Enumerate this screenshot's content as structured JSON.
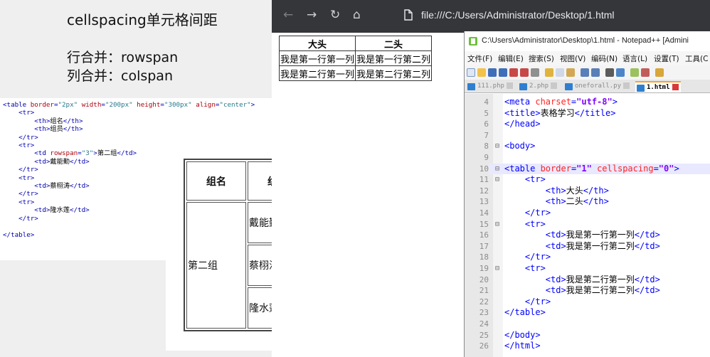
{
  "slide": {
    "title": "cellspacing单元格间距",
    "rowspan_line": "行合并：rowspan",
    "colspan_line": "列合并：colspan"
  },
  "code_snippet": {
    "lines": [
      "<table border=\"2px\" width=\"200px\" height=\"300px\" align=\"center\">",
      "    <tr>",
      "        <th>组名</th>",
      "        <th>组员</th>",
      "    </tr>",
      "    <tr>",
      "        <td rowspan=\"3\">第二组</td>",
      "        <td>戴能勤</td>",
      "    </tr>",
      "    <tr>",
      "        <td>蔡栩涛</td>",
      "    </tr>",
      "    <tr>",
      "        <td>隆水莲</td>",
      "    </tr>",
      "",
      "</table>"
    ]
  },
  "demo_table": {
    "headers": [
      "组名",
      "组员"
    ],
    "group": "第二组",
    "members": [
      "戴能勤",
      "蔡栩涛",
      "隆水莲"
    ]
  },
  "browser": {
    "url": "file:///C:/Users/Administrator/Desktop/1.html",
    "table": {
      "headers": [
        "大头",
        "二头"
      ],
      "rows": [
        [
          "我是第一行第一列",
          "我是第一行第二列"
        ],
        [
          "我是第二行第一列",
          "我是第二行第二列"
        ]
      ]
    }
  },
  "notepad": {
    "title": "C:\\Users\\Administrator\\Desktop\\1.html - Notepad++ [Admini",
    "menu": [
      "文件(F)",
      "编辑(E)",
      "搜索(S)",
      "视图(V)",
      "编码(N)",
      "语言(L)",
      "设置(T)",
      "工具(C"
    ],
    "tabs": [
      "111.php",
      "2.php",
      "oneforall.py",
      "1.html"
    ],
    "active_tab": "1.html",
    "lines": [
      {
        "n": "4",
        "fold": "",
        "text": "<meta charset=\"utf-8\">"
      },
      {
        "n": "5",
        "fold": "",
        "text": "<title>表格学习</title>"
      },
      {
        "n": "6",
        "fold": "",
        "text": "</head>"
      },
      {
        "n": "7",
        "fold": "",
        "text": ""
      },
      {
        "n": "8",
        "fold": "⊟",
        "text": "<body>"
      },
      {
        "n": "9",
        "fold": "",
        "text": ""
      },
      {
        "n": "10",
        "fold": "⊟",
        "text": "<table border=\"1\" cellspacing=\"0\">"
      },
      {
        "n": "11",
        "fold": "⊟",
        "text": "    <tr>"
      },
      {
        "n": "12",
        "fold": "",
        "text": "        <th>大头</th>"
      },
      {
        "n": "13",
        "fold": "",
        "text": "        <th>二头</th>"
      },
      {
        "n": "14",
        "fold": "",
        "text": "    </tr>"
      },
      {
        "n": "15",
        "fold": "⊟",
        "text": "    <tr>"
      },
      {
        "n": "16",
        "fold": "",
        "text": "        <td>我是第一行第一列</td>"
      },
      {
        "n": "17",
        "fold": "",
        "text": "        <td>我是第一行第二列</td>"
      },
      {
        "n": "18",
        "fold": "",
        "text": "    </tr>"
      },
      {
        "n": "19",
        "fold": "⊟",
        "text": "    <tr>"
      },
      {
        "n": "20",
        "fold": "",
        "text": "        <td>我是第二行第一列</td>"
      },
      {
        "n": "21",
        "fold": "",
        "text": "        <td>我是第二行第二列</td>"
      },
      {
        "n": "22",
        "fold": "",
        "text": "    </tr>"
      },
      {
        "n": "23",
        "fold": "",
        "text": "</table>"
      },
      {
        "n": "24",
        "fold": "",
        "text": ""
      },
      {
        "n": "25",
        "fold": "",
        "text": "</body>"
      },
      {
        "n": "26",
        "fold": "",
        "text": "</html>"
      }
    ],
    "highlight_line": "10"
  }
}
